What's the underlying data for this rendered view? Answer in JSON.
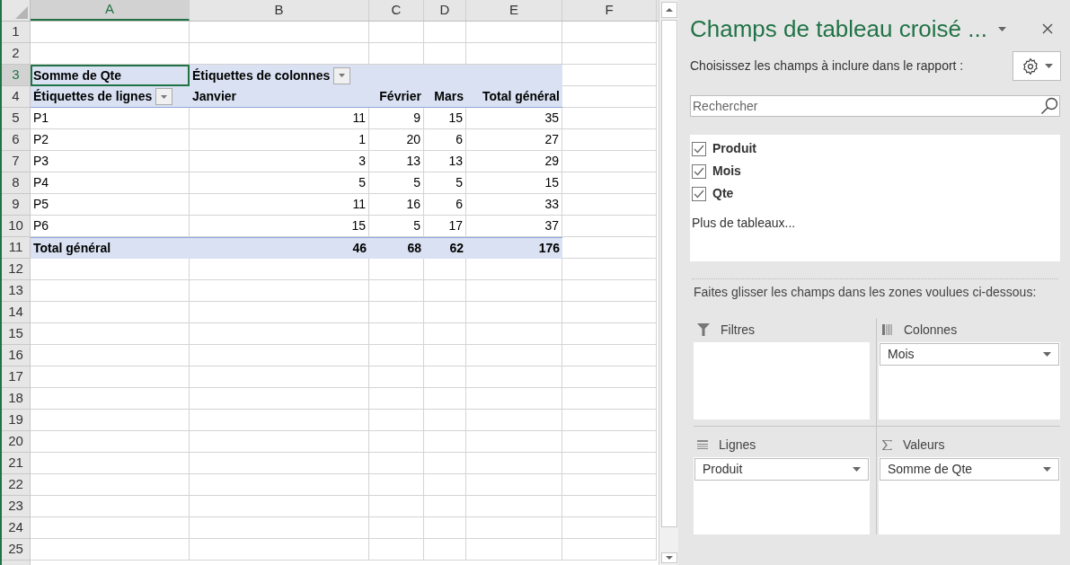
{
  "sheet": {
    "columns": [
      {
        "label": "A",
        "selected": true
      },
      {
        "label": "B",
        "selected": false
      },
      {
        "label": "C",
        "selected": false
      },
      {
        "label": "D",
        "selected": false
      },
      {
        "label": "E",
        "selected": false
      },
      {
        "label": "F",
        "selected": false
      }
    ],
    "rows": [
      {
        "label": "1",
        "selected": false
      },
      {
        "label": "2",
        "selected": false
      },
      {
        "label": "3",
        "selected": true
      },
      {
        "label": "4",
        "selected": false
      },
      {
        "label": "5",
        "selected": false
      },
      {
        "label": "6",
        "selected": false
      },
      {
        "label": "7",
        "selected": false
      },
      {
        "label": "8",
        "selected": false
      },
      {
        "label": "9",
        "selected": false
      },
      {
        "label": "10",
        "selected": false
      },
      {
        "label": "11",
        "selected": false
      },
      {
        "label": "12",
        "selected": false
      },
      {
        "label": "13",
        "selected": false
      },
      {
        "label": "14",
        "selected": false
      },
      {
        "label": "15",
        "selected": false
      },
      {
        "label": "16",
        "selected": false
      },
      {
        "label": "17",
        "selected": false
      },
      {
        "label": "18",
        "selected": false
      },
      {
        "label": "19",
        "selected": false
      },
      {
        "label": "20",
        "selected": false
      },
      {
        "label": "21",
        "selected": false
      },
      {
        "label": "22",
        "selected": false
      },
      {
        "label": "23",
        "selected": false
      },
      {
        "label": "24",
        "selected": false
      },
      {
        "label": "25",
        "selected": false
      }
    ]
  },
  "pivot": {
    "value_header": "Somme de Qte",
    "column_labels_header": "Étiquettes de colonnes",
    "row_labels_header": "Étiquettes de lignes",
    "column_headers": [
      "Janvier",
      "Février",
      "Mars",
      "Total général"
    ],
    "rows": [
      {
        "label": "P1",
        "values": [
          "11",
          "9",
          "15",
          "35"
        ]
      },
      {
        "label": "P2",
        "values": [
          "1",
          "20",
          "6",
          "27"
        ]
      },
      {
        "label": "P3",
        "values": [
          "3",
          "13",
          "13",
          "29"
        ]
      },
      {
        "label": "P4",
        "values": [
          "5",
          "5",
          "5",
          "15"
        ]
      },
      {
        "label": "P5",
        "values": [
          "11",
          "16",
          "6",
          "33"
        ]
      },
      {
        "label": "P6",
        "values": [
          "15",
          "5",
          "17",
          "37"
        ]
      }
    ],
    "total": {
      "label": "Total général",
      "values": [
        "46",
        "68",
        "62",
        "176"
      ]
    }
  },
  "panel": {
    "title": "Champs de tableau croisé ...",
    "instruction": "Choisissez les champs à inclure dans le rapport :",
    "search": {
      "placeholder": "Rechercher"
    },
    "fields": [
      {
        "label": "Produit",
        "checked": true
      },
      {
        "label": "Mois",
        "checked": true
      },
      {
        "label": "Qte",
        "checked": true
      }
    ],
    "more_tables": "Plus de tableaux...",
    "drag_hint": "Faites glisser les champs dans les zones voulues ci-dessous:",
    "areas": [
      {
        "kind": "filters",
        "label": "Filtres"
      },
      {
        "kind": "columns",
        "label": "Colonnes",
        "fields": [
          "Mois"
        ]
      },
      {
        "kind": "rows",
        "label": "Lignes",
        "fields": [
          "Produit"
        ]
      },
      {
        "kind": "values",
        "label": "Valeurs",
        "fields": [
          "Somme de Qte"
        ]
      }
    ]
  }
}
